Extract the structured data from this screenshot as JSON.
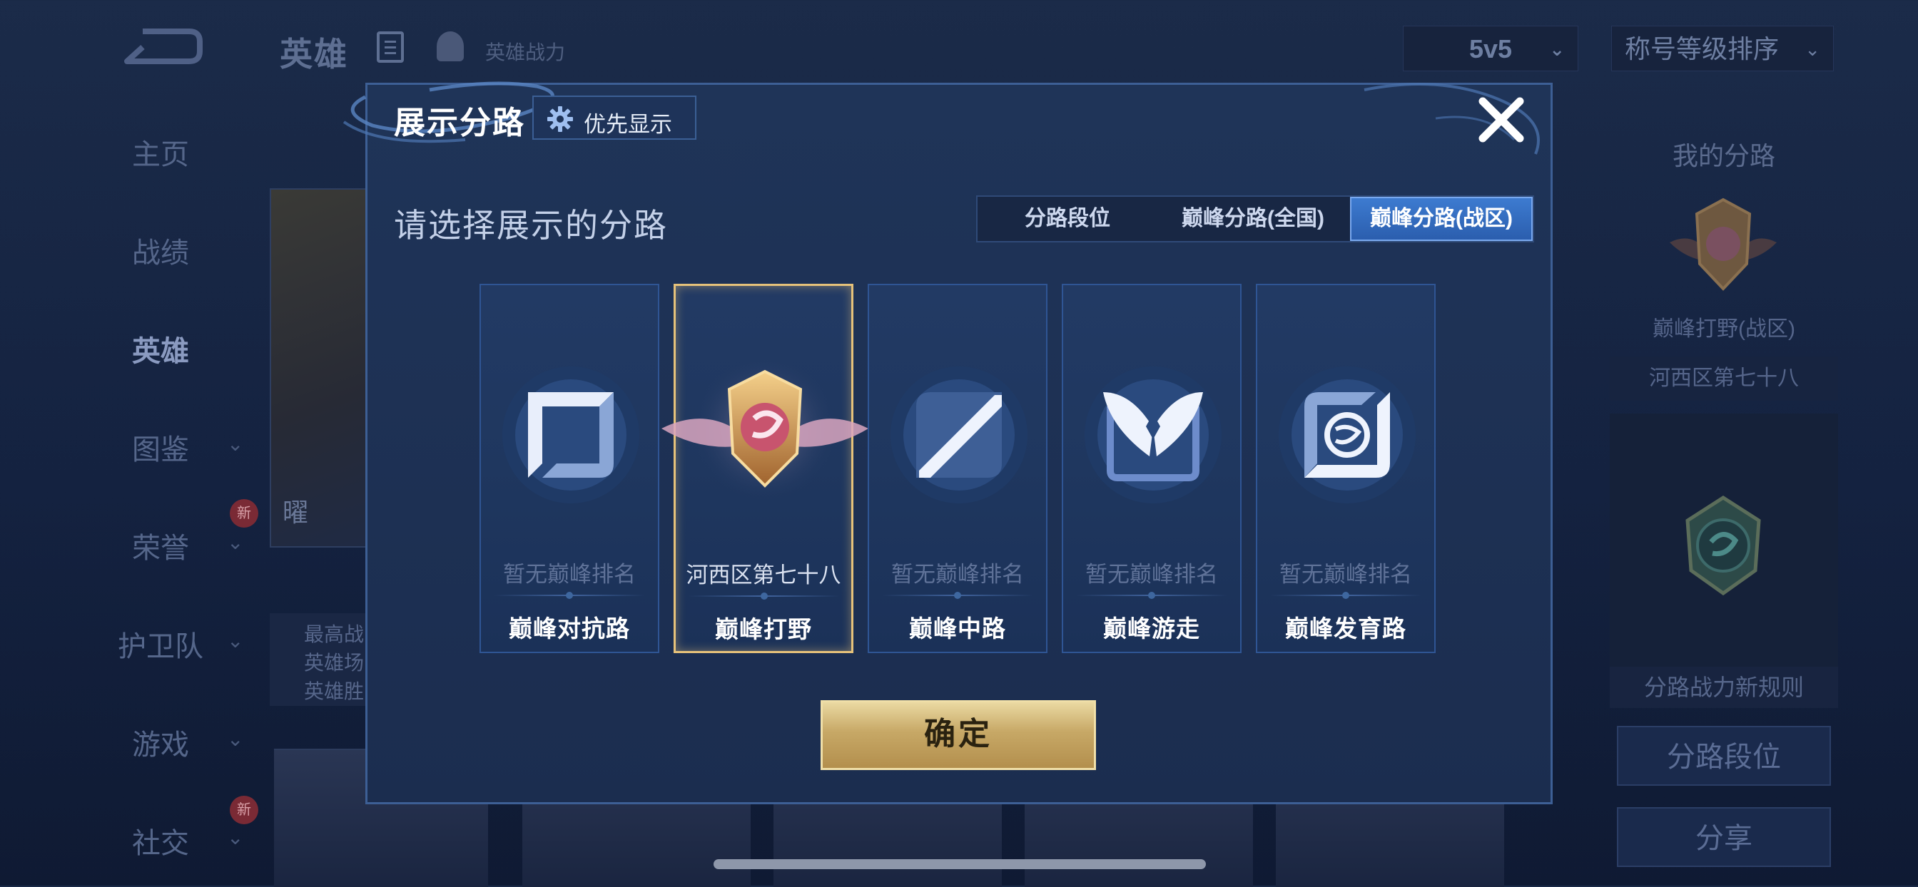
{
  "background": {
    "header": {
      "title": "英雄",
      "power_label": "英雄战力"
    },
    "mode_dropdown": "5v5",
    "sort_dropdown": "称号等级排序",
    "nav": [
      {
        "label": "主页",
        "has_chevron": false
      },
      {
        "label": "战绩",
        "has_chevron": false
      },
      {
        "label": "英雄",
        "has_chevron": false,
        "active": true
      },
      {
        "label": "图鉴",
        "has_chevron": true
      },
      {
        "label": "荣誉",
        "has_chevron": true,
        "badge": "新"
      },
      {
        "label": "护卫队",
        "has_chevron": true
      },
      {
        "label": "游戏",
        "has_chevron": true
      },
      {
        "label": "社交",
        "has_chevron": true,
        "badge": "新"
      }
    ],
    "hero_card_name": "曜",
    "hero_stats": [
      "最高战",
      "英雄场",
      "英雄胜"
    ],
    "right_panel": {
      "title": "我的分路",
      "lane_name": "巅峰打野(战区)",
      "region_rank": "河西区第七十八",
      "rule_label": "分路战力新规则",
      "lane_rank_button": "分路段位",
      "share_button": "分享"
    }
  },
  "modal": {
    "title": "展示分路",
    "priority_button": "优先显示",
    "section_title": "请选择展示的分路",
    "tabs": [
      {
        "label": "分路段位",
        "active": false
      },
      {
        "label": "巅峰分路(全国)",
        "active": false
      },
      {
        "label": "巅峰分路(战区)",
        "active": true
      }
    ],
    "cards": [
      {
        "icon": "sword-icon",
        "rank": "暂无巅峰排名",
        "name": "巅峰对抗路",
        "selected": false
      },
      {
        "icon": "jungle-emblem-icon",
        "rank": "河西区第七十八",
        "name": "巅峰打野",
        "selected": true
      },
      {
        "icon": "mid-lane-icon",
        "rank": "暂无巅峰排名",
        "name": "巅峰中路",
        "selected": false
      },
      {
        "icon": "wings-icon",
        "rank": "暂无巅峰排名",
        "name": "巅峰游走",
        "selected": false
      },
      {
        "icon": "bullseye-icon",
        "rank": "暂无巅峰排名",
        "name": "巅峰发育路",
        "selected": false
      }
    ],
    "confirm_button": "确定"
  },
  "colors": {
    "accent_gold": "#e6c27a",
    "tab_active_blue": "#3d7bd0",
    "modal_bg": "#1f3458"
  }
}
